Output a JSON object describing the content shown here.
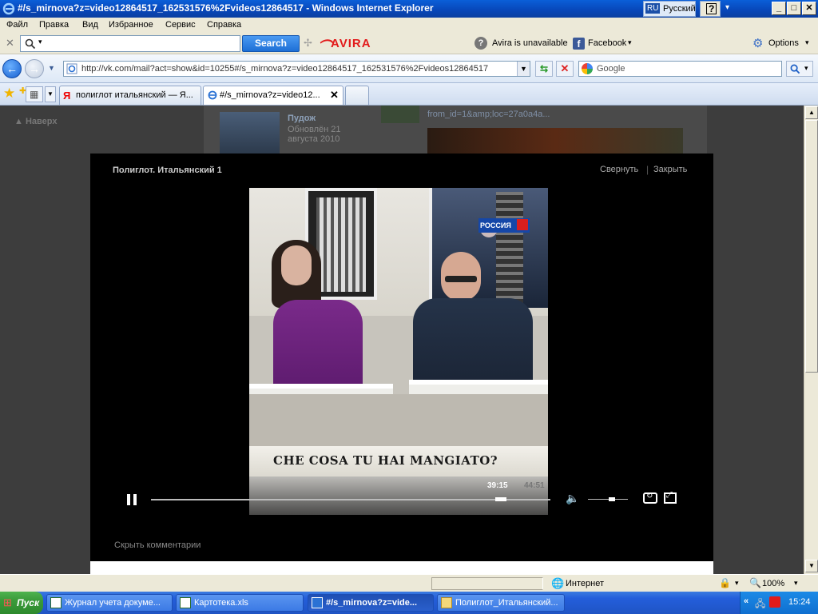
{
  "window": {
    "title": "#/s_mirnova?z=video12864517_162531576%2Fvideos12864517 - Windows Internet Explorer",
    "lang_code": "RU",
    "lang_name": "Русский",
    "help": "?",
    "min_glyph": "_",
    "max_glyph": "□",
    "close_glyph": "✕"
  },
  "menu": [
    "Файл",
    "Правка",
    "Вид",
    "Избранное",
    "Сервис",
    "Справка"
  ],
  "avira": {
    "search_label": "Search",
    "brand": "AVIRA",
    "unavailable": "Avira is unavailable",
    "facebook": "Facebook",
    "options": "Options",
    "search_value": ""
  },
  "address": {
    "url": "http://vk.com/mail?act=show&id=10255#/s_mirnova?z=video12864517_162531576%2Fvideos12864517",
    "search_placeholder": "Google"
  },
  "tabs": [
    {
      "label": "полиглот итальянский — Я...",
      "active": false
    },
    {
      "label": "#/s_mirnova?z=video12...",
      "active": true
    }
  ],
  "background_page": {
    "back_up": "▲ Наверх",
    "group_name": "Пудож",
    "group_updated": "Обновлён 21 августа 2010",
    "link_fragment": "from_id=1&amp;loc=27a0a4a..."
  },
  "video": {
    "title": "Полиглот. Итальянский 1",
    "minimize": "Свернуть",
    "close": "Закрыть",
    "caption": "CHE COSA TU HAI MANGIATO?",
    "channel_logo": "РОССИЯ",
    "time_current": "39:15",
    "time_total": "44:51",
    "progress": 0.875,
    "volume": 0.6,
    "hide_comments": "Скрыть комментарии"
  },
  "status": {
    "zone": "Интернет",
    "zoom": "100%"
  },
  "taskbar": {
    "start": "Пуск",
    "items": [
      {
        "label": "Журнал учета докуме...",
        "active": false
      },
      {
        "label": "Картотека.xls",
        "active": false
      },
      {
        "label": "#/s_mirnova?z=vide...",
        "active": true
      },
      {
        "label": "Полиглот_Итальянский...",
        "active": false
      }
    ],
    "clock": "15:24"
  },
  "colors": {
    "ie_blue": "#0a5fd8",
    "avira_red": "#e21b1b",
    "vk_player_bg": "#000000",
    "taskbar_blue": "#245edb"
  }
}
